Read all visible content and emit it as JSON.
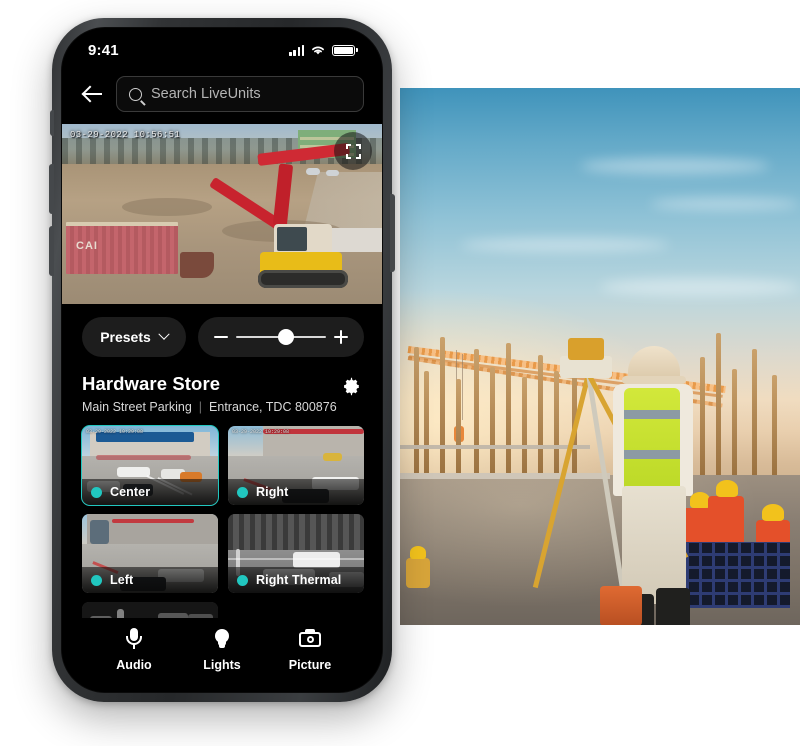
{
  "status_bar": {
    "time": "9:41",
    "signal_icon": "cellular-signal-icon",
    "wifi_icon": "wifi-icon",
    "battery_icon": "battery-full-icon"
  },
  "header": {
    "back_icon": "back-arrow-icon",
    "search_icon": "search-icon",
    "search_value": "",
    "search_placeholder": "Search LiveUnits"
  },
  "live_view": {
    "timestamp": "03-29-2022 10:56:51",
    "fullscreen_icon": "fullscreen-expand-icon"
  },
  "controls": {
    "presets_label": "Presets",
    "presets_chevron_icon": "chevron-down-icon",
    "zoom_out_icon": "minus-icon",
    "zoom_in_icon": "plus-icon",
    "zoom_value": 55
  },
  "site": {
    "title": "Hardware Store",
    "location": "Main Street Parking",
    "divider": "|",
    "detail": "Entrance,  TDC 800876",
    "settings_icon": "gear-icon"
  },
  "cameras": [
    {
      "label": "Center",
      "status_icon": "status-dot-online",
      "selected": true,
      "timestamp": "03-29-2022 10:29:08",
      "kind": "color-storefront"
    },
    {
      "label": "Right",
      "status_icon": "status-dot-online",
      "selected": false,
      "timestamp": "03-29-2022 10:29:08",
      "kind": "color-corner"
    },
    {
      "label": "Left",
      "status_icon": "status-dot-online",
      "selected": false,
      "timestamp": "",
      "kind": "color-left"
    },
    {
      "label": "Right Thermal",
      "status_icon": "status-dot-online",
      "selected": false,
      "timestamp": "",
      "kind": "thermal"
    },
    {
      "label": "",
      "status_icon": "",
      "selected": false,
      "timestamp": "",
      "kind": "night"
    }
  ],
  "bottom_nav": [
    {
      "label": "Audio",
      "icon": "microphone-icon"
    },
    {
      "label": "Lights",
      "icon": "lightbulb-icon"
    },
    {
      "label": "Picture",
      "icon": "camera-icon"
    }
  ],
  "colors": {
    "accent": "#21c7c0",
    "screen_bg": "#000000",
    "page_bg": "#ffffff",
    "control_bg": "#1d1d1d",
    "text_primary": "#ffffff",
    "text_secondary": "#d8d8d8"
  }
}
